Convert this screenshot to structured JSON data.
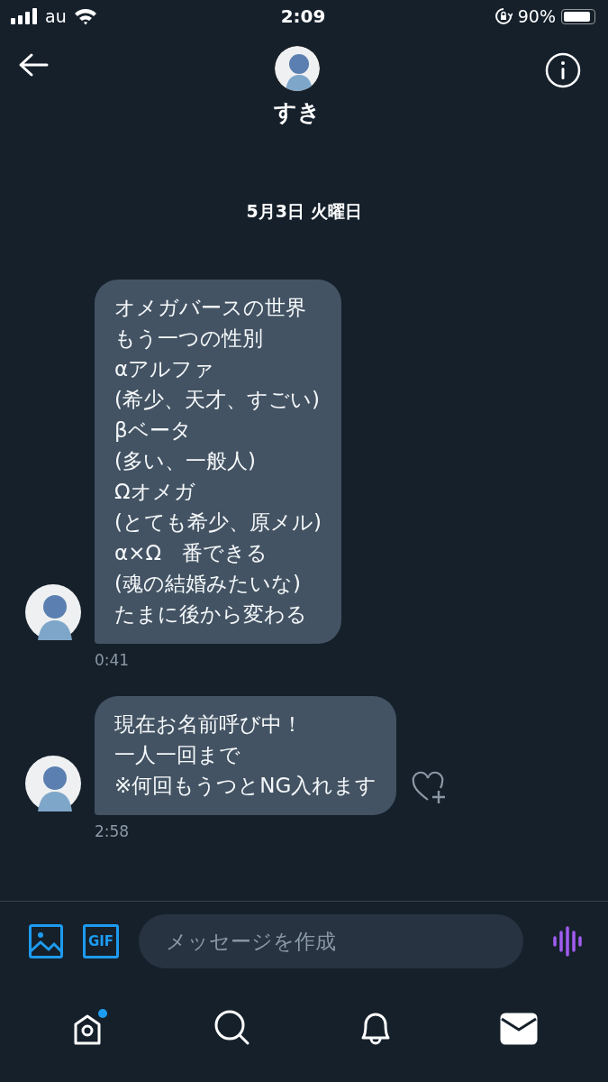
{
  "status_bar": {
    "carrier": "au",
    "time": "2:09",
    "battery": "90%"
  },
  "header": {
    "name": "すき"
  },
  "date": "5月3日 火曜日",
  "messages": [
    {
      "lines": [
        "オメガバースの世界",
        "もう一つの性別",
        "αアルファ",
        "(希少、天才、すごい)",
        "βベータ",
        "(多い、一般人)",
        "Ωオメガ",
        "(とても希少、原メル)",
        "α×Ω　番できる",
        "(魂の結婚みたいな)",
        "たまに後から変わる"
      ],
      "time": "0:41",
      "show_avatar": true,
      "reaction_button": false
    },
    {
      "lines": [
        "現在お名前呼び中！",
        "一人一回まで",
        "※何回もうつとNG入れます"
      ],
      "time": "2:58",
      "show_avatar": true,
      "reaction_button": true
    }
  ],
  "composer": {
    "gif_label": "GIF",
    "placeholder": "メッセージを作成"
  },
  "nav": [
    {
      "kind": "home",
      "selected": false,
      "badge": true
    },
    {
      "kind": "search",
      "selected": false,
      "badge": false
    },
    {
      "kind": "notifications",
      "selected": false,
      "badge": false
    },
    {
      "kind": "messages",
      "selected": true,
      "badge": false
    }
  ]
}
